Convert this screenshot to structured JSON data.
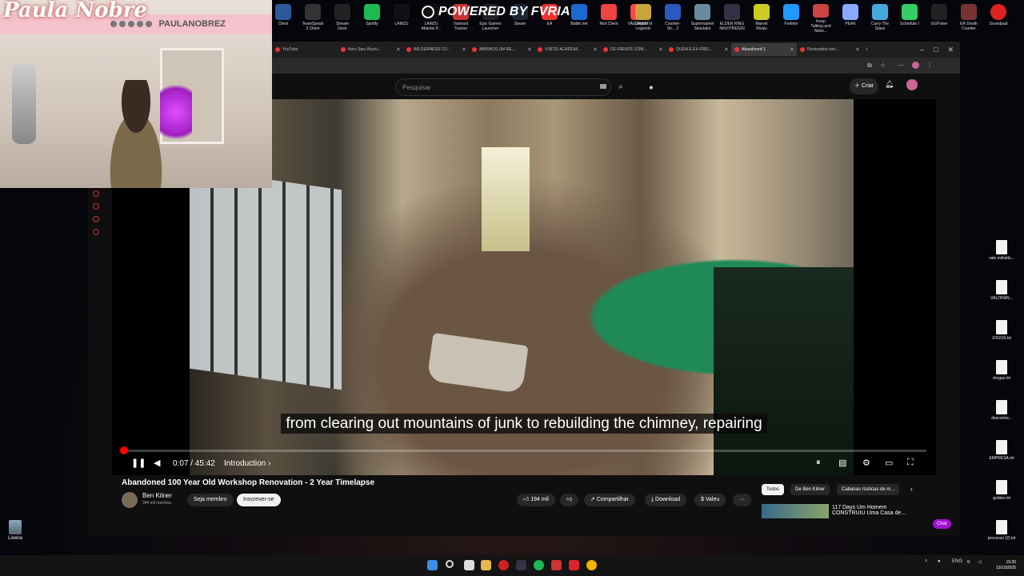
{
  "stream": {
    "logo_text": "Paula Nobre",
    "handle": "PAULANOBREZ",
    "powered_by": "POWERED BY FVRIA"
  },
  "top_apps_left": [
    {
      "label": "Client"
    },
    {
      "label": "TeamSpeak 3 Client"
    },
    {
      "label": "Stream Deck"
    },
    {
      "label": "Spotify"
    },
    {
      "label": "LAMZU"
    },
    {
      "label": "LAMZU Atlantis P..."
    },
    {
      "label": "Valorant Tracker"
    },
    {
      "label": "Epic Games Launcher"
    },
    {
      "label": "Steam"
    },
    {
      "label": "EA"
    },
    {
      "label": "Battle.net"
    },
    {
      "label": "Riot Client"
    },
    {
      "label": "VALORANT"
    }
  ],
  "top_apps_right": [
    {
      "label": "League of Legends"
    },
    {
      "label": "Counter-Str... 2"
    },
    {
      "label": "Supermarket Simulator"
    },
    {
      "label": "ELDEN RING NIGHTREIGN"
    },
    {
      "label": "Marvel Rivals"
    },
    {
      "label": "Fortnite"
    },
    {
      "label": "Keep Talking and Nobo..."
    },
    {
      "label": "PEAK"
    },
    {
      "label": "Carry The Glass"
    },
    {
      "label": "Schedule I"
    },
    {
      "label": "GGPoker"
    },
    {
      "label": "ER Death Counter"
    },
    {
      "label": "Soundpad"
    }
  ],
  "browser": {
    "tabs": [
      {
        "label": "YouTube"
      },
      {
        "label": "Noru Saru Bushi..."
      },
      {
        "label": "WILDERNESS CO..."
      },
      {
        "label": "ABRIMOS UM RE..."
      },
      {
        "label": "VISITEI ACADEMI..."
      },
      {
        "label": "DE FRENTE COM..."
      },
      {
        "label": "QUEM É EX-FREI..."
      },
      {
        "label": "Abandoned 1"
      },
      {
        "label": "Restoration extr..."
      }
    ],
    "new_tab": "+"
  },
  "youtube": {
    "search_placeholder": "Pesquisar",
    "create_label": "Criar",
    "caption": "from clearing out mountains of junk to rebuilding the chimney, repairing",
    "time": "0:07 / 45:42",
    "chapter": "Introduction",
    "progress_fraction": 0.0026,
    "video_title": "Abandoned 100 Year Old Workshop Renovation - 2 Year Timelapse",
    "channel_name": "Ben Kilner",
    "channel_subs": "344 mil inscritos",
    "join_label": "Seja membro",
    "subscribe_label": "Inscrever-se",
    "likes": "194 mil",
    "share_label": "Compartilhar",
    "download_label": "Download",
    "thanks_label": "Valeu",
    "more_label": "···",
    "chips": [
      {
        "label": "Todos"
      },
      {
        "label": "De Ben Kilner"
      },
      {
        "label": "Cabanas rústicas de m..."
      }
    ],
    "rec_title": "117 Days Um Homem CONSTRUIU Uma Casa de...",
    "chat_label": "Chat"
  },
  "desktop": {
    "files": [
      {
        "label": "valo individu..."
      },
      {
        "label": "VALORAN..."
      },
      {
        "label": "JOGOS.txt"
      },
      {
        "label": "drogas.txt"
      },
      {
        "label": "descontoi..."
      },
      {
        "label": "EMPRESA.txt"
      },
      {
        "label": "golden.txt"
      },
      {
        "label": "processo (2).txt"
      }
    ],
    "trash_label": "Lixeira"
  },
  "taskbar": {
    "lang": "ENG",
    "time": "15:30",
    "date": "13/10/2025"
  },
  "colors": {
    "youtube_red": "#ff0000",
    "bg": "#0f0f0f",
    "chip": "#272727"
  }
}
